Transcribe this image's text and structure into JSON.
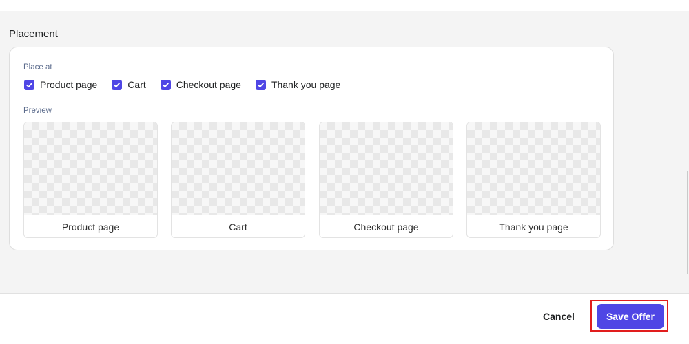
{
  "placement": {
    "title": "Placement",
    "place_at_label": "Place at",
    "preview_label": "Preview",
    "options": [
      {
        "label": "Product page",
        "checked": true
      },
      {
        "label": "Cart",
        "checked": true
      },
      {
        "label": "Checkout page",
        "checked": true
      },
      {
        "label": "Thank you page",
        "checked": true
      }
    ],
    "previews": [
      {
        "caption": "Product page"
      },
      {
        "caption": "Cart"
      },
      {
        "caption": "Checkout page"
      },
      {
        "caption": "Thank you page"
      }
    ]
  },
  "footer": {
    "cancel_label": "Cancel",
    "save_label": "Save Offer"
  },
  "colors": {
    "accent": "#4f46e5",
    "highlight": "#e11d1d",
    "background": "#f4f4f4"
  },
  "icons": {
    "checkbox": "check-icon"
  }
}
